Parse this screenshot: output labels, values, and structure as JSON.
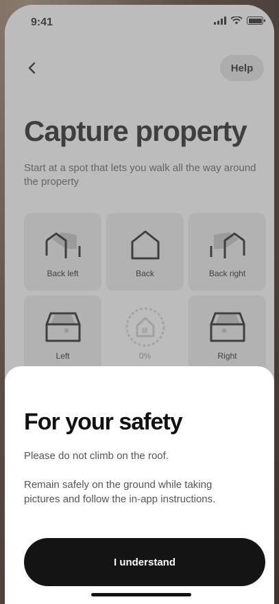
{
  "status_bar": {
    "time": "9:41"
  },
  "header": {
    "back_icon": "chevron-left-icon",
    "help_label": "Help"
  },
  "page": {
    "title": "Capture property",
    "subtitle": "Start at a spot that lets you walk all the way around the property"
  },
  "capture_grid": {
    "tiles": [
      {
        "label": "Back left",
        "icon": "house-back-left-icon"
      },
      {
        "label": "Back",
        "icon": "house-back-icon"
      },
      {
        "label": "Back right",
        "icon": "house-back-right-icon"
      },
      {
        "label": "Left",
        "icon": "house-left-icon"
      },
      {
        "label": "0%",
        "icon": "house-progress-icon",
        "progress": 0
      },
      {
        "label": "Right",
        "icon": "house-right-icon"
      }
    ]
  },
  "safety_sheet": {
    "title": "For your safety",
    "line1": "Please do not climb on the roof.",
    "line2": "Remain safely on the ground while taking pictures and follow the in-app instructions.",
    "button_label": "I understand"
  },
  "colors": {
    "primary": "#141414",
    "tile_bg": "#e2e2e2",
    "overlay": "rgba(120,120,120,0.45)"
  }
}
